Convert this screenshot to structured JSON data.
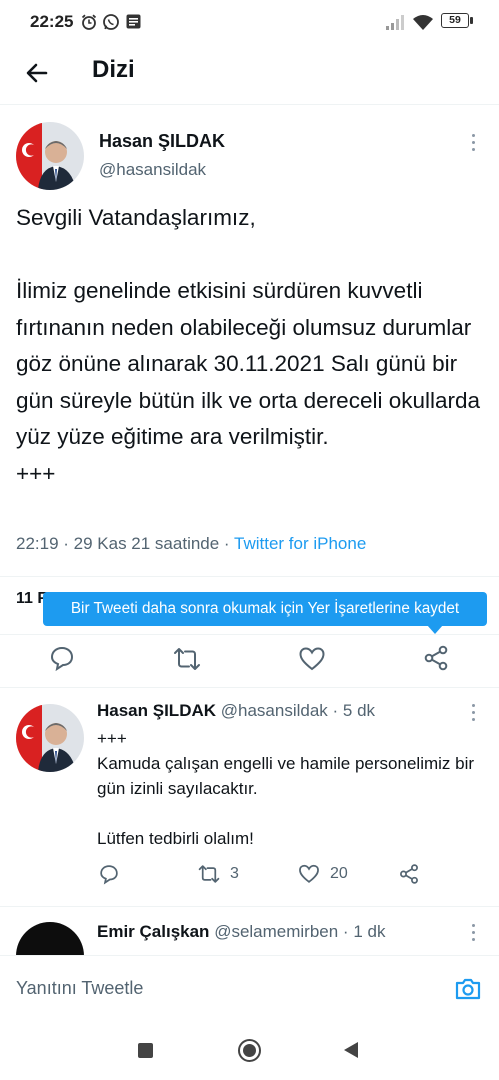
{
  "status_bar": {
    "time": "22:25",
    "battery": "59",
    "icons": [
      "alarm-icon",
      "whatsapp-icon",
      "message-icon",
      "signal-icon",
      "wifi-icon",
      "battery-icon"
    ]
  },
  "header": {
    "title": "Dizi"
  },
  "main_tweet": {
    "name": "Hasan ŞILDAK",
    "handle": "@hasansildak",
    "text": "Sevgili Vatandaşlarımız,\n\nİlimiz genelinde etkisini sürdüren kuvvetli fırtınanın neden olabileceği olumsuz durumlar göz önüne alınarak 30.11.2021 Salı günü bir gün süreyle bütün ilk ve orta dereceli okullarda yüz yüze eğitime ara verilmiştir.\n+++",
    "timestamp": "22:19 · 29 Kas 21 saatinde · ",
    "source": "Twitter for iPhone",
    "stats_partial": "11 F"
  },
  "tooltip": {
    "text": "Bir Tweeti daha sonra okumak için Yer İşaretlerine kaydet"
  },
  "reply_tweet": {
    "name": "Hasan ŞILDAK",
    "handle_time": "@hasansildak · 5 dk",
    "text": "+++\nKamuda çalışan engelli ve hamile personelimiz bir gün izinli sayılacaktır.\n\nLütfen tedbirli olalım!",
    "retweets": "3",
    "likes": "20"
  },
  "next_tweet": {
    "name": "Emir Çalışkan",
    "handle_time": "@selamemirben · 1 dk"
  },
  "composer": {
    "placeholder": "Yanıtını Tweetle"
  },
  "colors": {
    "accent": "#1d9bf0",
    "text": "#0f1419",
    "muted": "#536471"
  }
}
